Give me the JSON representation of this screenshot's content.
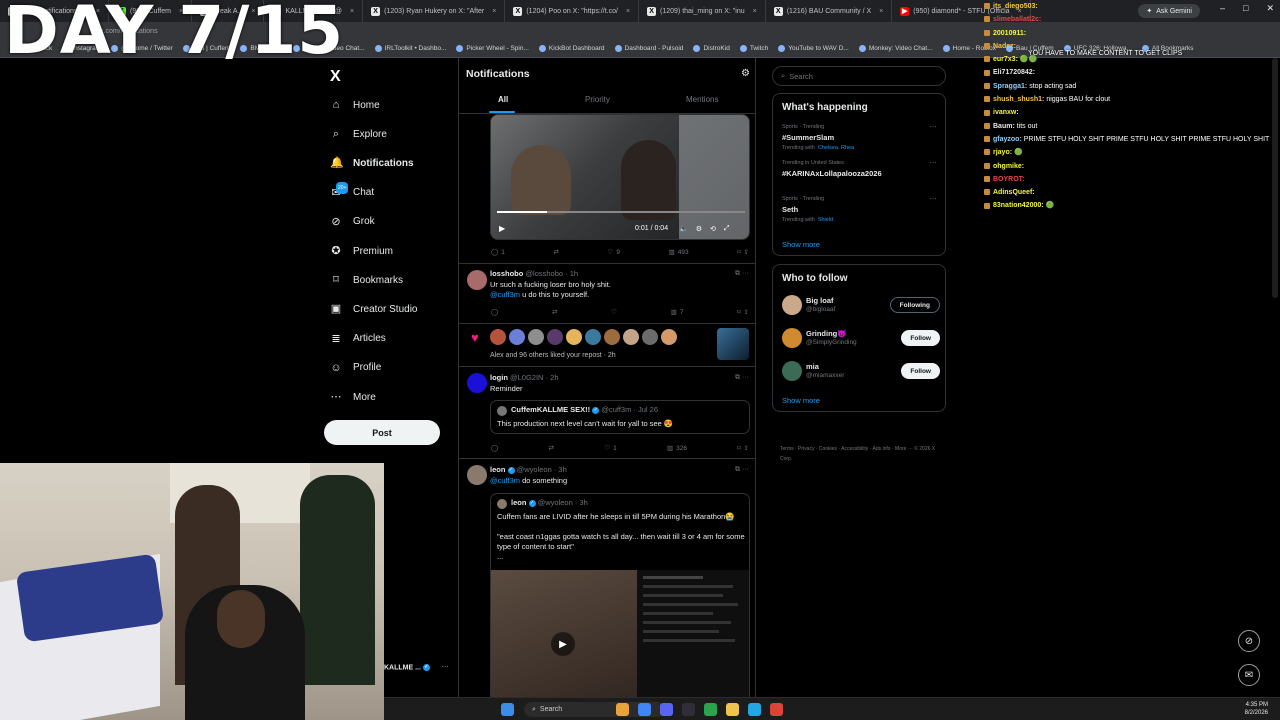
{
  "browser": {
    "tabs": [
      {
        "label": "(272) Notifications / X",
        "icon": "x-favicon"
      },
      {
        "label": "(99+) Cuffem",
        "icon": "kick-favicon"
      },
      {
        "label": "Break A...",
        "icon": "x-favicon"
      },
      {
        "label": "KALLME SEX!! @",
        "icon": "x-favicon"
      },
      {
        "label": "(1203) Ryan Hukery on X: \"After",
        "icon": "x-favicon"
      },
      {
        "label": "(1204) Poo on X: \"https://t.co/",
        "icon": "x-favicon"
      },
      {
        "label": "(1209) thai_ming on X: \"inu",
        "icon": "x-favicon"
      },
      {
        "label": "(1216) BAU Community / X",
        "icon": "x-favicon"
      },
      {
        "label": "(950) diamond* - STFU (Officia",
        "icon": "youtube-favicon"
      }
    ],
    "url": "x.com/notifications",
    "ask_gemini": "Ask Gemini",
    "bookmarks": [
      "Kick",
      "Instagram",
      "(1) Home / Twitter",
      "Bau | Cuffem",
      "BMONKEY",
      "OmeTV Video Chat...",
      "IRLToolkit • Dashbo...",
      "Picker Wheel - Spin...",
      "KickBot Dashboard",
      "Dashboard - Pulsoid",
      "DistroKid",
      "Twitch",
      "YouTube to WAV D...",
      "Monkey: Video Chat...",
      "Home - Roblox",
      "Bau | Cuffem",
      "UFC 326: Hollowa...",
      "All Bookmarks"
    ]
  },
  "overlay": {
    "day_counter": "DAY 7/15",
    "marquee": "YOU HAVE TO MAKE CONTENT TO GET CLIPS"
  },
  "sidebar": {
    "logo": "X",
    "items": [
      {
        "label": "Home",
        "icon": "home-icon"
      },
      {
        "label": "Explore",
        "icon": "search-icon"
      },
      {
        "label": "Notifications",
        "icon": "bell-icon",
        "active": true
      },
      {
        "label": "Chat",
        "icon": "chat-icon",
        "badge": "20+"
      },
      {
        "label": "Grok",
        "icon": "grok-icon"
      },
      {
        "label": "Premium",
        "icon": "premium-icon"
      },
      {
        "label": "Bookmarks",
        "icon": "bookmark-icon"
      },
      {
        "label": "Creator Studio",
        "icon": "studio-icon"
      },
      {
        "label": "Articles",
        "icon": "articles-icon"
      },
      {
        "label": "Profile",
        "icon": "person-icon"
      },
      {
        "label": "More",
        "icon": "more-icon"
      }
    ],
    "post_label": "Post",
    "account_name": "KALLME ..."
  },
  "main": {
    "title": "Notifications",
    "tabs": [
      {
        "label": "All",
        "active": true
      },
      {
        "label": "Priority"
      },
      {
        "label": "Mentions"
      }
    ],
    "video_post": {
      "time": "0:01 / 0:04",
      "replies": "1",
      "likes": "9",
      "views": "493"
    },
    "reply1": {
      "name": "losshobo",
      "handle": "@losshobo · 1h",
      "text": "Ur such a fucking loser bro holy shit.",
      "mention": "@cuff3m",
      "text2": " u do this to yourself.",
      "views": "7"
    },
    "likes_notice": "Alex and 96 others liked your repost · 2h",
    "reply2": {
      "name": "login",
      "handle": "@L0G2IN · 2h",
      "text": "Reminder",
      "quote_name": "CuffemKALLME SEX!!",
      "quote_handle": "@cuff3m · Jul 26",
      "quote_text": "This production next level can't wait for yall to see 😍",
      "likes": "1",
      "views": "326"
    },
    "reply3": {
      "name": "leon",
      "handle": "@wyoleon · 3h",
      "mention": "@cuff3m",
      "text2": " do something",
      "quote_name": "leon",
      "quote_handle": "@wyoleon · 3h",
      "quote_text": "Cuffem fans are LIVID after he sleeps in till 5PM during his Marathon😭",
      "quote_text2": "\"east coast n1ggas gotta watch ts all day... then wait till 3 or 4 am for some type of content to start\"",
      "quote_text3": "..."
    }
  },
  "right": {
    "search_placeholder": "Search",
    "happening_title": "What's happening",
    "trends": [
      {
        "meta": "Sports · Trending",
        "name": "#SummerSlam",
        "with_label": "Trending with",
        "with": "Chelsea, Rhea"
      },
      {
        "meta": "Trending in United States",
        "name": "#KARINAxLollapalooza2026",
        "with_label": "",
        "with": ""
      },
      {
        "meta": "Sports · Trending",
        "name": "Seth",
        "with_label": "Trending with",
        "with": "Shield"
      }
    ],
    "show_more": "Show more",
    "follow_title": "Who to follow",
    "follow": [
      {
        "name": "Big loaf",
        "handle": "@bigloaaf",
        "button": "Following",
        "color": "#c9a98a"
      },
      {
        "name": "Grinding😈",
        "handle": "@SimplyGrinding",
        "button": "Follow",
        "color": "#d08a2f"
      },
      {
        "name": "mia",
        "handle": "@miamaxxer",
        "button": "Follow",
        "color": "#3b6b55"
      }
    ],
    "footer": "Terms · Privacy · Cookies · Accessibility · Ads info · More ··· © 2026 X Corp."
  },
  "chat": [
    {
      "name": "its_diego503:",
      "msg": "",
      "color": "#f5c542"
    },
    {
      "name": "slimeballatl2c:",
      "msg": "",
      "color": "#e04a4a"
    },
    {
      "name": "20010911:",
      "msg": "",
      "color": "#f5f542"
    },
    {
      "name": "Nadez:",
      "msg": "",
      "color": "#f5c542"
    },
    {
      "name": "eur7x3:",
      "msg": "🟢🟢",
      "color": "#f5f542"
    },
    {
      "name": "Eli71720842:",
      "msg": "",
      "color": "#e7e9ea"
    },
    {
      "name": "Spragga1:",
      "msg": "stop acting sad",
      "color": "#8fd1ff"
    },
    {
      "name": "shush_shush1:",
      "msg": "niggas BAU for clout",
      "color": "#f5c542"
    },
    {
      "name": "ivanxw:",
      "msg": "",
      "color": "#f5f542"
    },
    {
      "name": "Baum:",
      "msg": "tits out",
      "color": "#e7e9ea"
    },
    {
      "name": "gfayzoo:",
      "msg": "PRIME STFU HOLY SHIT PRIME STFU HOLY SHIT PRIME STFU HOLY SHIT",
      "color": "#8fd1ff"
    },
    {
      "name": "rjayo:",
      "msg": "🟢",
      "color": "#f5f542"
    },
    {
      "name": "ohgmike:",
      "msg": "",
      "color": "#f5f542"
    },
    {
      "name": "BOYROT:",
      "msg": "",
      "color": "#e04a4a"
    },
    {
      "name": "AdinsQueef:",
      "msg": "",
      "color": "#f5f542"
    },
    {
      "name": "83nation42000:",
      "msg": "🟢",
      "color": "#f5f542"
    }
  ],
  "taskbar": {
    "search_placeholder": "Search",
    "time": "4:35 PM",
    "date": "8/2/2026"
  },
  "colors": {
    "accent": "#1d9bf0",
    "like": "#f91880",
    "bg": "#000000"
  }
}
